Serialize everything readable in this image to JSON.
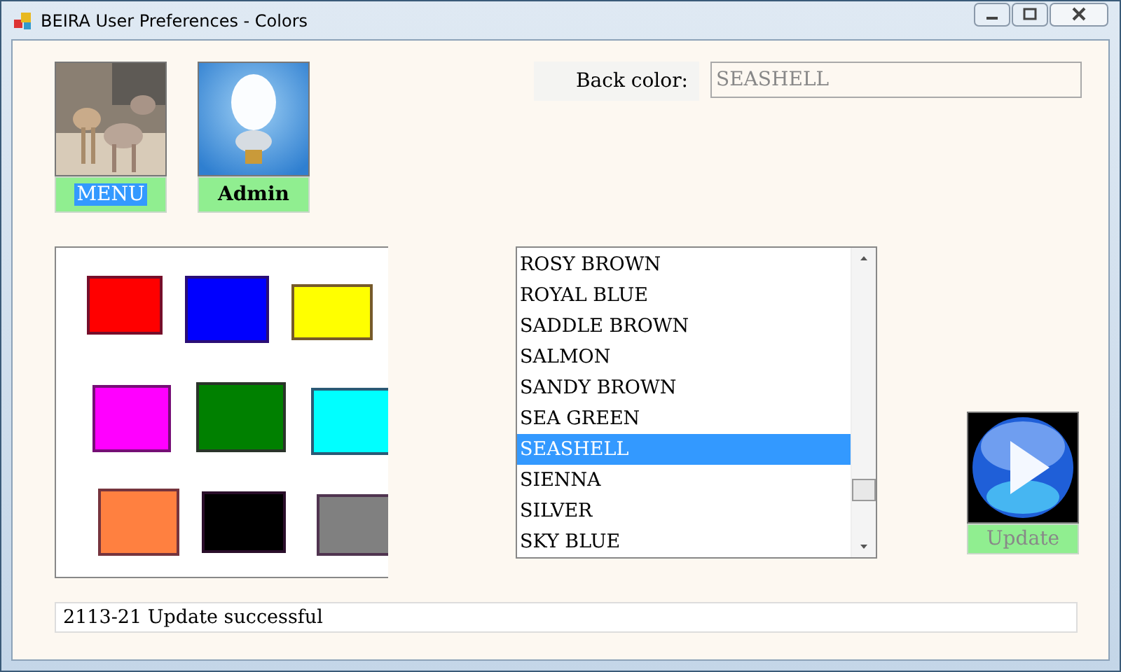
{
  "window": {
    "title": "BEIRA User Preferences - Colors"
  },
  "tiles": [
    {
      "kind": "animals",
      "label": "MENU",
      "selected": true
    },
    {
      "kind": "bulb",
      "label": "Admin",
      "selected": false
    }
  ],
  "back_color": {
    "label": "Back color:",
    "value": "SEASHELL"
  },
  "swatches": [
    {
      "color": "#ff0000"
    },
    {
      "color": "#0000ff"
    },
    {
      "color": "#ffff00"
    },
    {
      "color": "#ff00ff"
    },
    {
      "color": "#008000"
    },
    {
      "color": "#00ffff"
    },
    {
      "color": "#ff8040"
    },
    {
      "color": "#000000"
    },
    {
      "color": "#808080"
    }
  ],
  "color_list": [
    {
      "label": "ROSY BROWN",
      "selected": false
    },
    {
      "label": "ROYAL BLUE",
      "selected": false
    },
    {
      "label": "SADDLE BROWN",
      "selected": false
    },
    {
      "label": "SALMON",
      "selected": false
    },
    {
      "label": "SANDY BROWN",
      "selected": false
    },
    {
      "label": "SEA GREEN",
      "selected": false
    },
    {
      "label": "SEASHELL",
      "selected": true
    },
    {
      "label": "SIENNA",
      "selected": false
    },
    {
      "label": "SILVER",
      "selected": false
    },
    {
      "label": "SKY BLUE",
      "selected": false
    }
  ],
  "update_button": {
    "label": "Update",
    "disabled": true
  },
  "status": "2113-21 Update successful"
}
